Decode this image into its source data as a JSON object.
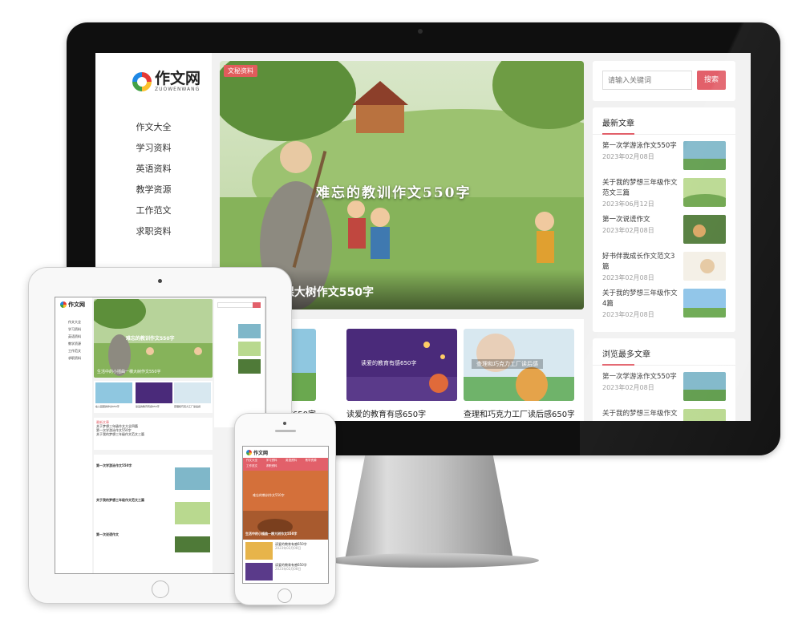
{
  "desktop": {
    "logo": {
      "cn": "作文网",
      "en": "ZUOWENWANG"
    },
    "nav": [
      "作文大全",
      "学习资料",
      "英语资料",
      "教学资源",
      "工作范文",
      "求职资料"
    ],
    "hero": {
      "tag": "文秘资料",
      "overlay": "难忘的教训作文550字",
      "caption": "生活中的小插曲一棵大树作文550字"
    },
    "cards": [
      {
        "title": "在公园里的作文650字"
      },
      {
        "title": "读爱的教育有感650字",
        "overlay": "读爱的教育有感650字"
      },
      {
        "title": "查理和巧克力工厂读后感650字",
        "overlay": "查理和巧克力工厂读后感"
      }
    ],
    "search": {
      "placeholder": "请输入关键词",
      "button": "搜索"
    },
    "latest": {
      "title": "最新文章",
      "items": [
        {
          "title": "第一次学游泳作文550字",
          "date": "2023年02月08日"
        },
        {
          "title": "关于我的梦想三年级作文范文三篇",
          "date": "2023年06月12日"
        },
        {
          "title": "第一次说谎作文",
          "date": "2023年02月08日"
        },
        {
          "title": "好书伴我成长作文范文3篇",
          "date": "2023年02月08日"
        },
        {
          "title": "关于我的梦想三年级作文4篇",
          "date": "2023年02月08日"
        }
      ]
    },
    "popular": {
      "title": "浏览最多文章",
      "items": [
        {
          "title": "第一次学游泳作文550字",
          "date": "2023年02月08日"
        },
        {
          "title": "关于我的梦想三年级作文",
          "date": ""
        }
      ]
    }
  },
  "tablet": {
    "logo": "作文网",
    "nav": [
      "作文大全",
      "学习资料",
      "英语资料",
      "教学资源",
      "工作范文",
      "求职资料"
    ],
    "hero_overlay": "难忘的教训作文550字",
    "hero_caption": "生活中的小插曲一棵大树作文550字",
    "cards": [
      "在公园里的作文650字",
      "读爱的教育有感650字",
      "查理和巧克力工厂读后感"
    ],
    "list_heading": "最新文章",
    "list_items": [
      "关于梦想三年级作文大全四篇",
      "第一次学游泳作文550字",
      "关于我的梦想三年级作文范文三篇"
    ],
    "article_titles": [
      "第一次学游泳作文550字",
      "关于我的梦想三年级作文范文三篇",
      "第一次说谎作文"
    ]
  },
  "phone": {
    "logo": "作文网",
    "nav": [
      "作文大全",
      "学习资料",
      "英语资料",
      "教学资源",
      "工作范文",
      "求职资料"
    ],
    "hero_overlay": "难忘的教训作文550字",
    "hero_caption": "生活中的小插曲一棵大树作文550字",
    "items": [
      {
        "title": "读爱的教育有感650字",
        "date": "2023年02月08日"
      },
      {
        "title": "读爱的教育有感650字",
        "date": "2023年02月08日"
      }
    ]
  },
  "colors": {
    "accent": "#e2606a",
    "tag": "#e25c5c",
    "bezel": "#0f0f0f"
  }
}
